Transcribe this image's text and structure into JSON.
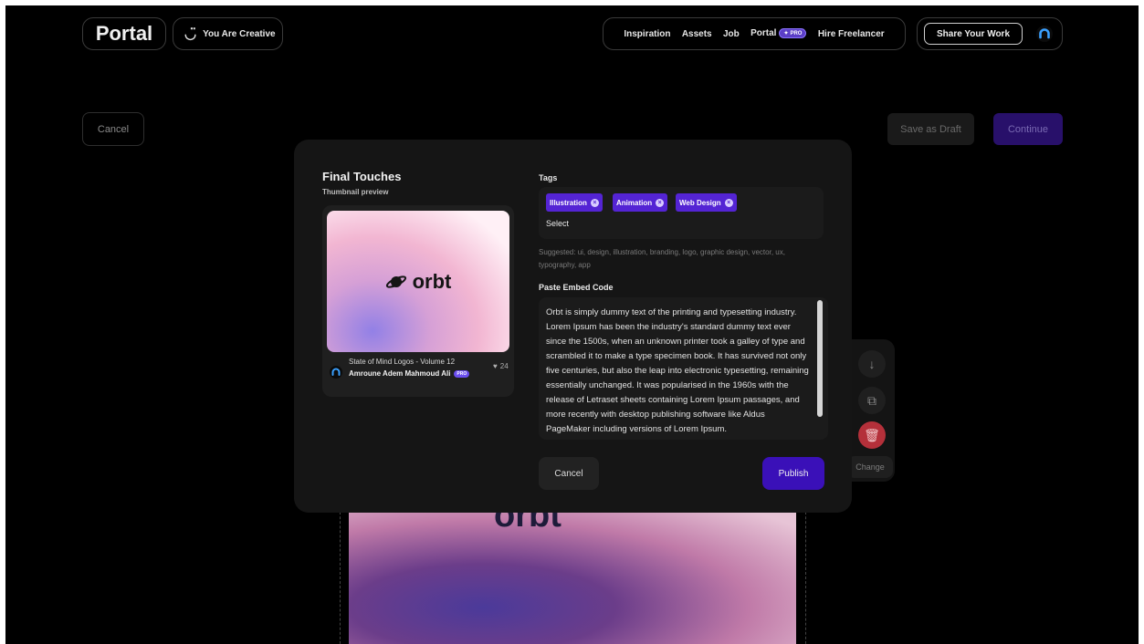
{
  "header": {
    "logo": "Portal",
    "creative_label": "You Are Creative",
    "nav": [
      "Inspiration",
      "Assets",
      "Job",
      "Portal",
      "Hire Freelancer"
    ],
    "pro_badge": "PRO",
    "share_label": "Share Your Work"
  },
  "page": {
    "cancel_label": "Cancel",
    "save_draft_label": "Save as Draft",
    "continue_label": "Continue",
    "change_label": "Change",
    "canvas_logo": "orbt"
  },
  "modal": {
    "title": "Final Touches",
    "subtitle": "Thumbnail preview",
    "card": {
      "logo": "orbt",
      "title": "State of Mind Logos - Volume 12",
      "author": "Amroune Adem Mahmoud Ali",
      "pro_badge": "PRO",
      "likes": "24"
    },
    "tags_label": "Tags",
    "tags": [
      "Illustration",
      "Animation",
      "Web Design"
    ],
    "select_placeholder": "Select",
    "suggested": "Suggested: ui, design, illustration, branding, logo, graphic design, vector, ux, typography, app",
    "embed_label": "Paste Embed Code",
    "embed_text": "Orbt is simply dummy text of the printing and typesetting industry. Lorem Ipsum has been the industry's standard dummy text ever since the 1500s, when an unknown printer took a galley of type and scrambled it to make a type specimen book. It has survived not only five centuries, but also the leap into electronic typesetting, remaining essentially unchanged. It was popularised in the 1960s with the release of Letraset sheets containing Lorem Ipsum passages, and more recently with desktop publishing software like Aldus PageMaker including versions of Lorem Ipsum.",
    "cancel_label": "Cancel",
    "publish_label": "Publish"
  },
  "colors": {
    "accent": "#5424d4",
    "publish": "#3a10b8",
    "trash": "#b4303a"
  }
}
